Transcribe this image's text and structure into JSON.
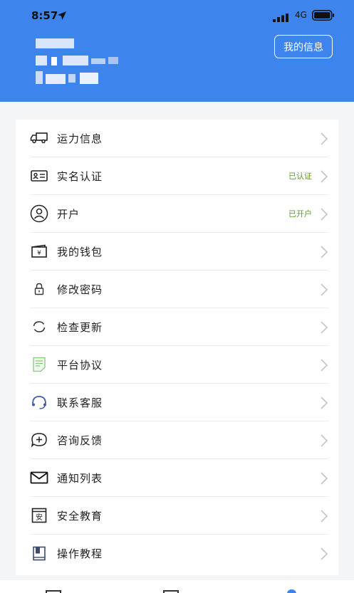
{
  "status_bar": {
    "time": "8:57",
    "network": "4G"
  },
  "header": {
    "my_info_button": "我的信息"
  },
  "menu": [
    {
      "label": "运力信息",
      "status": "",
      "icon": "truck-icon"
    },
    {
      "label": "实名认证",
      "status": "已认证",
      "icon": "id-card-icon"
    },
    {
      "label": "开户",
      "status": "已开户",
      "icon": "user-circle-icon"
    },
    {
      "label": "我的钱包",
      "status": "",
      "icon": "wallet-icon"
    },
    {
      "label": "修改密码",
      "status": "",
      "icon": "lock-icon"
    },
    {
      "label": "检查更新",
      "status": "",
      "icon": "refresh-icon"
    },
    {
      "label": "平台协议",
      "status": "",
      "icon": "document-icon"
    },
    {
      "label": "联系客服",
      "status": "",
      "icon": "headset-icon"
    },
    {
      "label": "咨询反馈",
      "status": "",
      "icon": "chat-plus-icon"
    },
    {
      "label": "通知列表",
      "status": "",
      "icon": "mail-icon"
    },
    {
      "label": "安全教育",
      "status": "",
      "icon": "safety-book-icon"
    },
    {
      "label": "操作教程",
      "status": "",
      "icon": "tutorial-book-icon"
    }
  ],
  "colors": {
    "header_bg": "#3d85ec",
    "status_green": "#5b9a28",
    "accent_blue": "#3d85ec"
  }
}
